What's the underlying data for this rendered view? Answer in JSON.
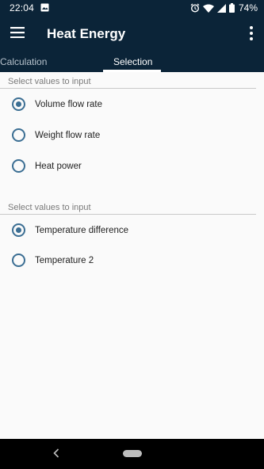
{
  "status_bar": {
    "time": "22:04",
    "battery": "74%",
    "icons": [
      "image-icon",
      "alarm-icon",
      "wifi-icon",
      "signal-icon",
      "battery-icon"
    ]
  },
  "app_bar": {
    "title": "Heat Energy",
    "icons": [
      "menu-icon",
      "overflow-menu-icon"
    ]
  },
  "tabs": [
    {
      "label": "Calculation",
      "selected": false
    },
    {
      "label": "Selection",
      "selected": true
    }
  ],
  "groups": [
    {
      "header": "Select values to input",
      "options": [
        {
          "label": "Volume flow rate",
          "checked": true
        },
        {
          "label": "Weight flow rate",
          "checked": false
        },
        {
          "label": "Heat power",
          "checked": false
        }
      ]
    },
    {
      "header": "Select values to input",
      "options": [
        {
          "label": "Temperature difference",
          "checked": true
        },
        {
          "label": "Temperature 2",
          "checked": false
        }
      ]
    }
  ],
  "colors": {
    "app_bar": "#0b2438",
    "accent": "#3b6e93",
    "background": "#fafafa"
  }
}
